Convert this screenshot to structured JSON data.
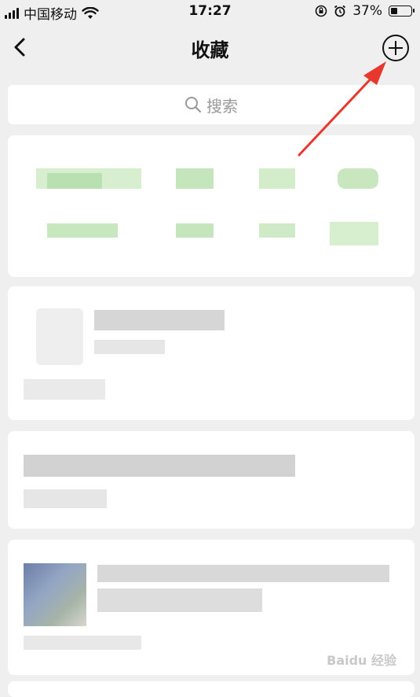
{
  "status_bar": {
    "carrier": "中国移动",
    "time": "17:27",
    "battery": "37%",
    "battery_level": 0.37
  },
  "nav": {
    "back_icon": "chevron-left-icon",
    "title": "收藏",
    "add_icon": "plus-circle-icon"
  },
  "search": {
    "icon": "search-icon",
    "placeholder": "搜索"
  },
  "colors": {
    "background": "#efefef",
    "card": "#ffffff",
    "annotation_arrow": "#e8372c",
    "blur_green": "#bfe3b8"
  },
  "watermark": {
    "text": "Baidu 经验"
  }
}
